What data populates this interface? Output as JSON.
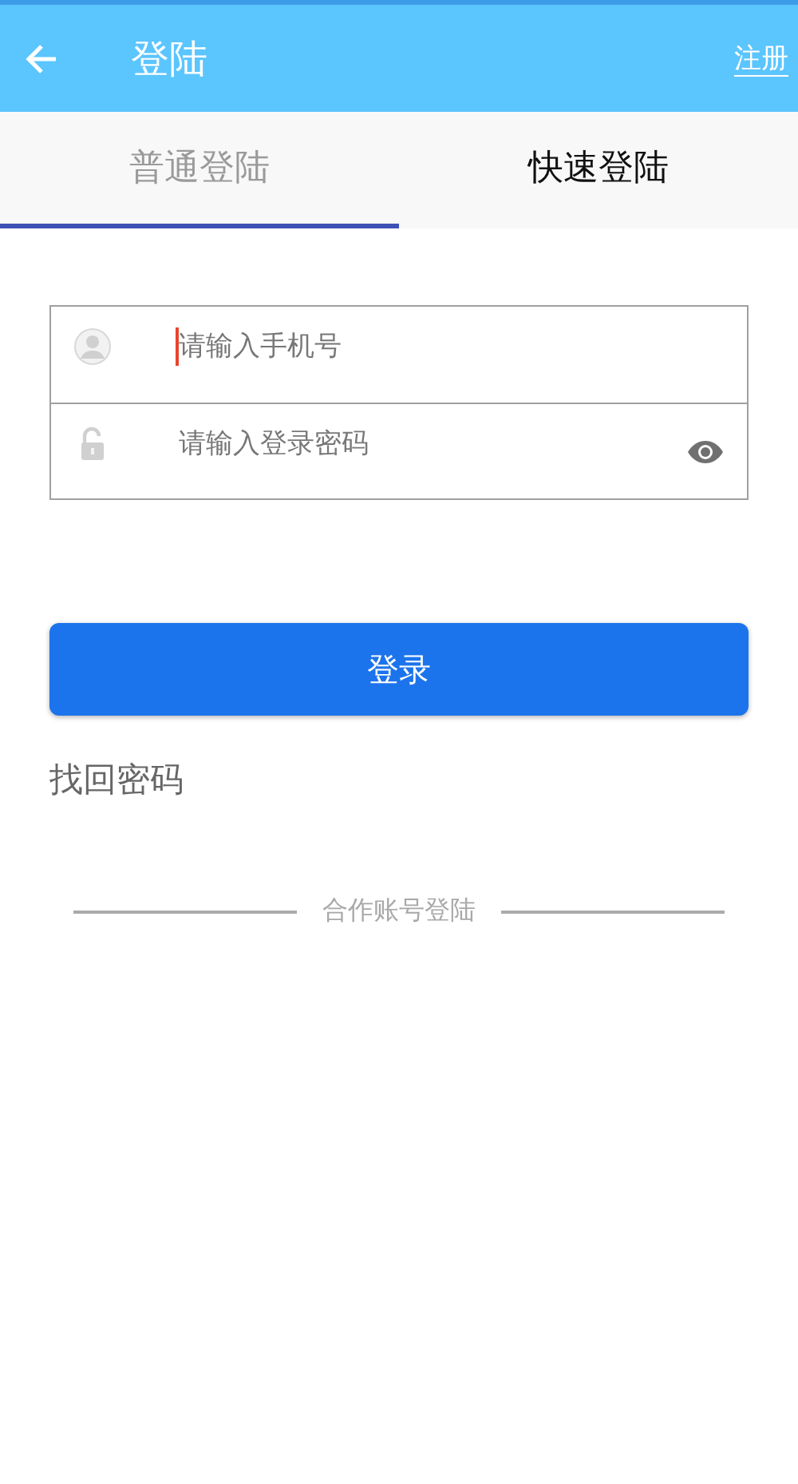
{
  "header": {
    "title": "登陆",
    "action": "注册"
  },
  "tabs": [
    {
      "label": "普通登陆",
      "selected": true
    },
    {
      "label": "快速登陆",
      "selected": false
    }
  ],
  "form": {
    "fields": [
      {
        "kind": "phone",
        "placeholder": "请输入手机号",
        "focused": true
      },
      {
        "kind": "password",
        "placeholder": "请输入登录密码",
        "focused": false
      }
    ]
  },
  "login_button": "登录",
  "forgot_link": "找回密码",
  "partner_divider": "合作账号登陆"
}
